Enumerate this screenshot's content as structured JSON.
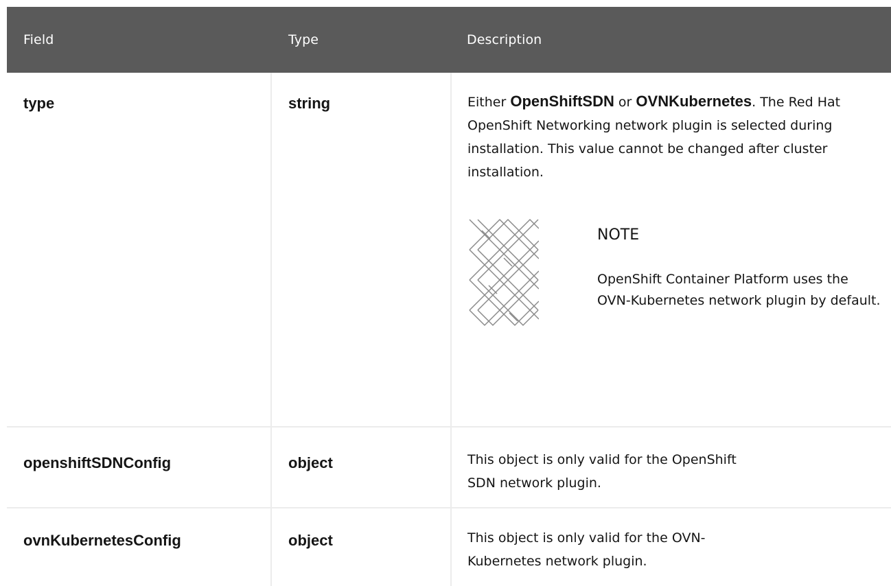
{
  "table": {
    "headers": {
      "field": "Field",
      "type": "Type",
      "description": "Description"
    },
    "rows": [
      {
        "field": "type",
        "type": "string",
        "desc_prefix": "Either ",
        "desc_bold1": "OpenShiftSDN",
        "desc_mid": " or ",
        "desc_bold2": "OVNKubernetes",
        "desc_suffix": ". The Red Hat OpenShift Networking network plugin is selected during installation. This value cannot be changed after cluster installation.",
        "note": {
          "icon": "note-pattern-icon",
          "title": "NOTE",
          "text": "OpenShift Container Platform uses the OVN-Kubernetes network plugin by default."
        }
      },
      {
        "field": "openshiftSDNConfig",
        "type": "object",
        "description": "This object is only valid for the OpenShift SDN network plugin."
      },
      {
        "field": "ovnKubernetesConfig",
        "type": "object",
        "description": "This object is only valid for the OVN-Kubernetes network plugin."
      }
    ]
  },
  "colors": {
    "header_bg": "#5a5a5a",
    "header_text": "#ffffff",
    "grid": "#ececec",
    "text": "#151515"
  }
}
